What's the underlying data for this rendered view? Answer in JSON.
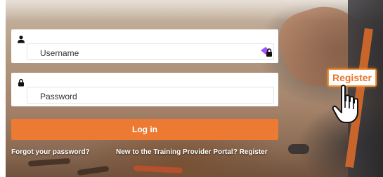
{
  "login_form": {
    "username_placeholder": "Username",
    "password_placeholder": "Password",
    "login_label": "Log in",
    "forgot_password_label": "Forgot your password?",
    "register_prompt_label": "New to the Training Provider Portal? Register"
  },
  "callout": {
    "register_label": "Register"
  },
  "colors": {
    "accent": "#ec7a33",
    "callout_border": "#f0923a",
    "callout_text": "#e8742c"
  },
  "icons": {
    "username_icon": "user-icon",
    "password_icon": "lock-icon",
    "password_manager_icon": "password-manager-icon",
    "cursor": "hand-pointer-icon"
  }
}
